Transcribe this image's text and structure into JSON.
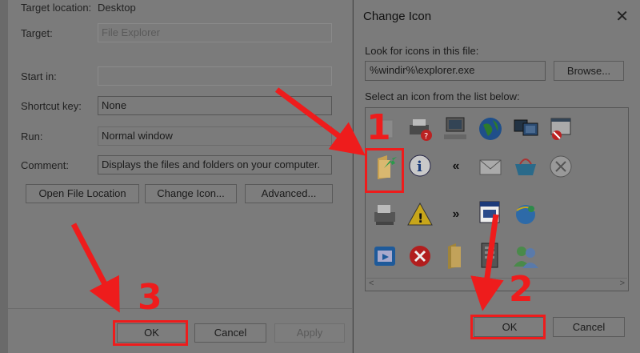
{
  "properties": {
    "target_location_label": "Target location:",
    "target_location_value": "Desktop",
    "target_label": "Target:",
    "target_value": "File Explorer",
    "start_in_label": "Start in:",
    "start_in_value": "",
    "shortcut_key_label": "Shortcut key:",
    "shortcut_key_value": "None",
    "run_label": "Run:",
    "run_value": "Normal window",
    "comment_label": "Comment:",
    "comment_value": "Displays the files and folders on your computer.",
    "open_file_location": "Open File Location",
    "change_icon": "Change Icon...",
    "advanced": "Advanced...",
    "ok": "OK",
    "cancel": "Cancel",
    "apply": "Apply"
  },
  "change_icon_dialog": {
    "title": "Change Icon",
    "look_label": "Look for icons in this file:",
    "path_value": "%windir%\\explorer.exe",
    "browse": "Browse...",
    "select_label": "Select an icon from the list below:",
    "ok": "OK",
    "cancel": "Cancel",
    "icons": [
      "blank-icon",
      "printer-help-icon",
      "computer-icon",
      "globe-icon",
      "monitors-icon",
      "blocked-window-icon",
      "folder-arrow-icon",
      "info-icon",
      "double-left-icon",
      "envelope-icon",
      "basket-icon",
      "circle-x-icon",
      "fax-icon",
      "warning-icon",
      "double-right-icon",
      "document-window-icon",
      "ie-globe-icon",
      "blue-window-icon",
      "red-x-icon",
      "folder-open-icon",
      "server-icon",
      "users-icon"
    ],
    "selected_icon": "folder-arrow-icon"
  },
  "annotations": {
    "step1": "1",
    "step2": "2",
    "step3": "3",
    "color": "#ee1c1c"
  }
}
